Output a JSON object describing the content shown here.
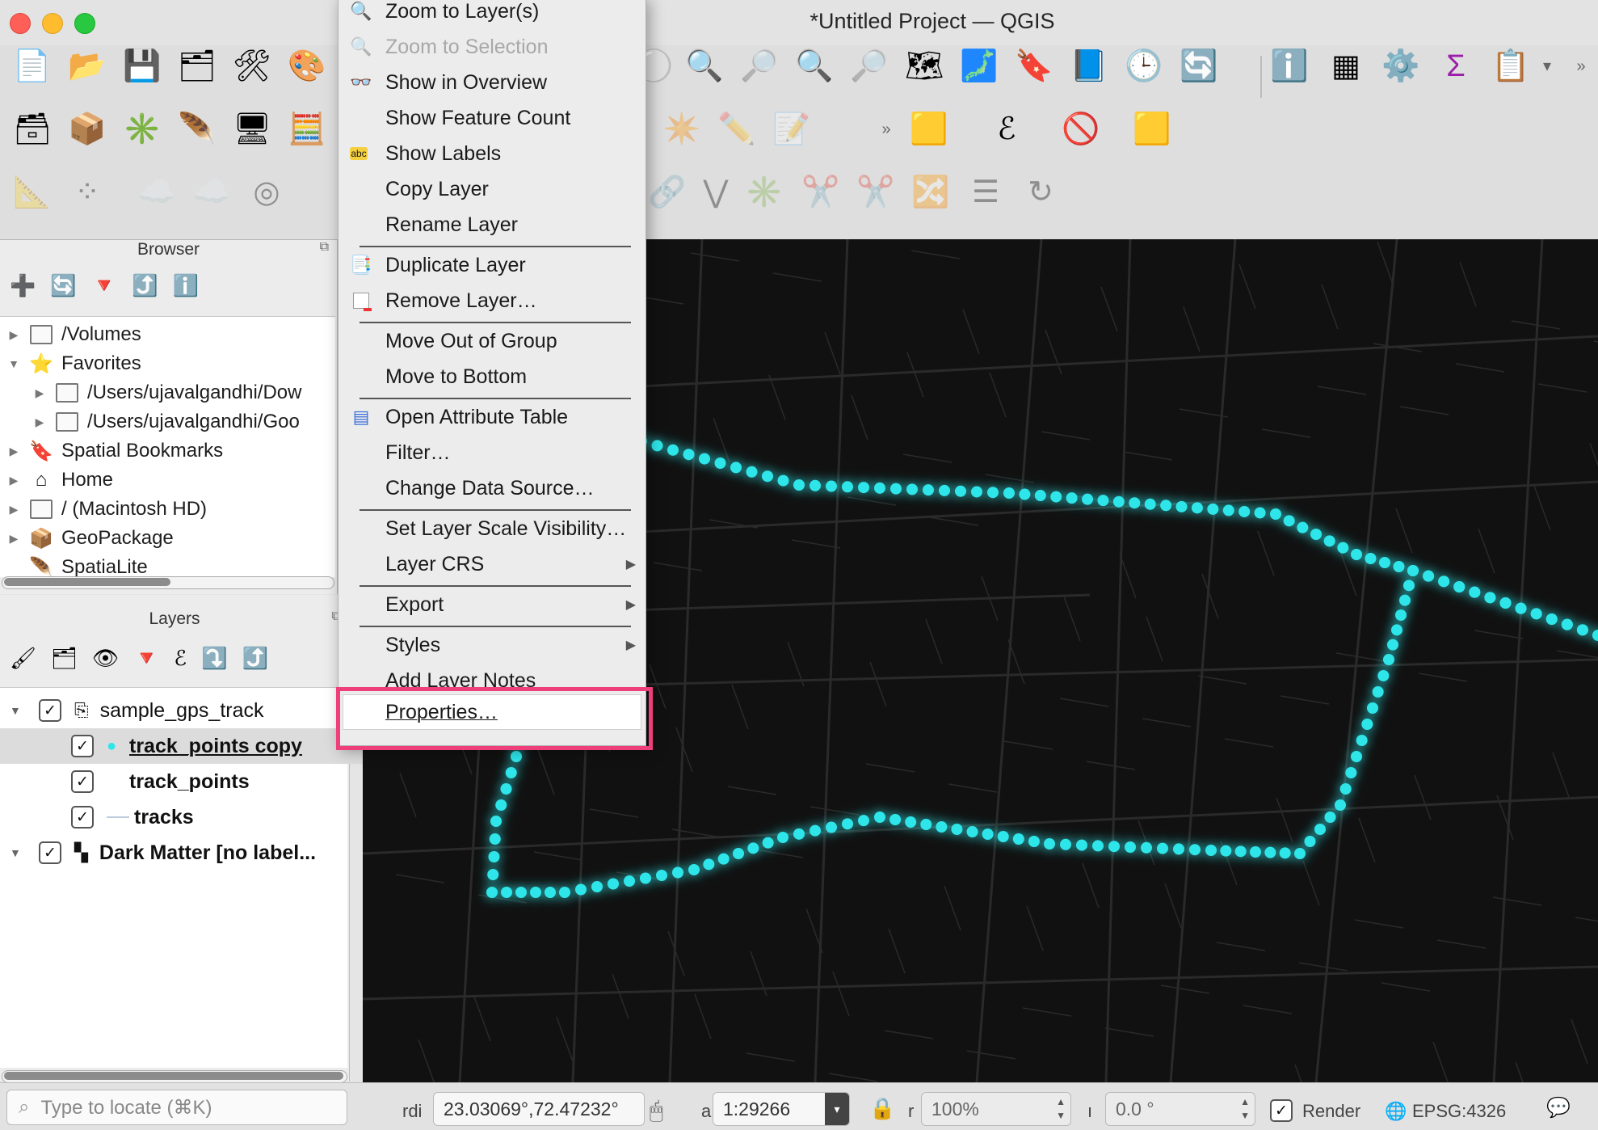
{
  "window": {
    "title": "*Untitled Project — QGIS"
  },
  "browser": {
    "title": "Browser",
    "items": [
      {
        "label": "/Volumes",
        "icon": "folder-icon",
        "expanded": false,
        "indent": 0
      },
      {
        "label": "Favorites",
        "icon": "star-icon",
        "expanded": true,
        "indent": 0
      },
      {
        "label": "/Users/ujavalgandhi/Dow",
        "icon": "folder-icon",
        "expanded": false,
        "indent": 1
      },
      {
        "label": "/Users/ujavalgandhi/Goo",
        "icon": "folder-icon",
        "expanded": false,
        "indent": 1
      },
      {
        "label": "Spatial Bookmarks",
        "icon": "bookmark-icon",
        "expanded": false,
        "indent": 0
      },
      {
        "label": "Home",
        "icon": "home-icon",
        "expanded": false,
        "indent": 0
      },
      {
        "label": "/ (Macintosh HD)",
        "icon": "folder-icon",
        "expanded": false,
        "indent": 0
      },
      {
        "label": "GeoPackage",
        "icon": "geopackage-icon",
        "expanded": false,
        "indent": 0
      },
      {
        "label": "SpatiaLite",
        "icon": "feather-icon",
        "expanded": false,
        "indent": 0
      }
    ]
  },
  "layers": {
    "title": "Layers",
    "items": [
      {
        "label": "sample_gps_track",
        "checked": true,
        "group": true,
        "bold": false
      },
      {
        "label": "track_points copy",
        "checked": true,
        "bold": true,
        "selected": true,
        "underline": true
      },
      {
        "label": "track_points",
        "checked": true,
        "bold": true
      },
      {
        "label": "tracks",
        "checked": true,
        "bold": true
      },
      {
        "label": "Dark Matter [no label...",
        "checked": true,
        "bold": true,
        "group": true
      }
    ]
  },
  "context_menu": {
    "items": [
      {
        "label": "Zoom to Layer(s)",
        "icon": "zoom-layer-icon",
        "enabled": true
      },
      {
        "label": "Zoom to Selection",
        "icon": "zoom-selection-icon",
        "enabled": false
      },
      {
        "label": "Show in Overview",
        "icon": "glasses-icon",
        "enabled": true
      },
      {
        "label": "Show Feature Count",
        "enabled": true
      },
      {
        "label": "Show Labels",
        "icon": "labels-icon",
        "enabled": true
      },
      {
        "label": "Copy Layer",
        "enabled": true
      },
      {
        "label": "Rename Layer",
        "enabled": true
      },
      {
        "label": "Duplicate Layer",
        "icon": "duplicate-icon",
        "enabled": true
      },
      {
        "label": "Remove Layer…",
        "icon": "remove-layer-icon",
        "enabled": true
      },
      {
        "label": "Move Out of Group",
        "enabled": true
      },
      {
        "label": "Move to Bottom",
        "enabled": true
      },
      {
        "label": "Open Attribute Table",
        "icon": "table-icon",
        "enabled": true
      },
      {
        "label": "Filter…",
        "enabled": true
      },
      {
        "label": "Change Data Source…",
        "enabled": true
      },
      {
        "label": "Set Layer Scale Visibility…",
        "enabled": true
      },
      {
        "label": "Layer CRS",
        "enabled": true,
        "submenu": true
      },
      {
        "label": "Export",
        "enabled": true,
        "submenu": true
      },
      {
        "label": "Styles",
        "enabled": true,
        "submenu": true
      },
      {
        "label": "Add Layer Notes",
        "enabled": true
      },
      {
        "label": "Properties…",
        "enabled": true,
        "highlighted": true
      }
    ]
  },
  "statusbar": {
    "locate_placeholder": "Type to locate (⌘K)",
    "coord_label": "rdi",
    "coordinate": "23.03069°,72.47232°",
    "scale_label": "a",
    "scale": "1:29266",
    "mag_label": "r",
    "magnifier": "100%",
    "rot_label": "ı",
    "rotation": "0.0 °",
    "render_label": "Render",
    "render_checked": true,
    "crs": "EPSG:4326"
  },
  "colors": {
    "accent_highlight": "#ef3f7a",
    "track": "#2ee6ea",
    "map_bg": "#111111"
  }
}
